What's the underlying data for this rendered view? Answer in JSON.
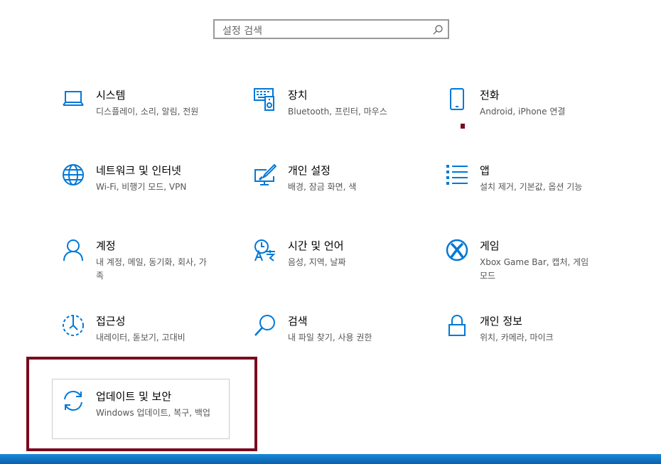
{
  "search": {
    "placeholder": "설정 검색",
    "icon": "search-icon"
  },
  "tiles": [
    {
      "title": "시스템",
      "subtitle": "디스플레이, 소리, 알림, 전원",
      "icon": "laptop-icon"
    },
    {
      "title": "장치",
      "subtitle": "Bluetooth, 프린터, 마우스",
      "icon": "devices-icon"
    },
    {
      "title": "전화",
      "subtitle": "Android, iPhone 연결",
      "icon": "phone-icon"
    },
    {
      "title": "네트워크 및 인터넷",
      "subtitle": "Wi-Fi, 비행기 모드, VPN",
      "icon": "globe-icon"
    },
    {
      "title": "개인 설정",
      "subtitle": "배경, 잠금 화면, 색",
      "icon": "personalization-icon"
    },
    {
      "title": "앱",
      "subtitle": "설치 제거, 기본값, 옵션 기능",
      "icon": "apps-list-icon"
    },
    {
      "title": "계정",
      "subtitle": "내 계정, 메일, 동기화, 회사, 가족",
      "icon": "person-icon"
    },
    {
      "title": "시간 및 언어",
      "subtitle": "음성, 지역, 날짜",
      "icon": "time-language-icon"
    },
    {
      "title": "게임",
      "subtitle": "Xbox Game Bar, 캡처, 게임 모드",
      "icon": "xbox-icon"
    },
    {
      "title": "접근성",
      "subtitle": "내레이터, 돋보기, 고대비",
      "icon": "accessibility-icon"
    },
    {
      "title": "검색",
      "subtitle": "내 파일 찾기, 사용 권한",
      "icon": "search-icon"
    },
    {
      "title": "개인 정보",
      "subtitle": "위치, 카메라, 마이크",
      "icon": "lock-icon"
    },
    {
      "title": "업데이트 및 보안",
      "subtitle": "Windows 업데이트, 복구, 백업",
      "icon": "sync-icon"
    }
  ],
  "colors": {
    "accent": "#0078d7",
    "highlight": "#7a0a1e",
    "subtitle": "#555555"
  }
}
